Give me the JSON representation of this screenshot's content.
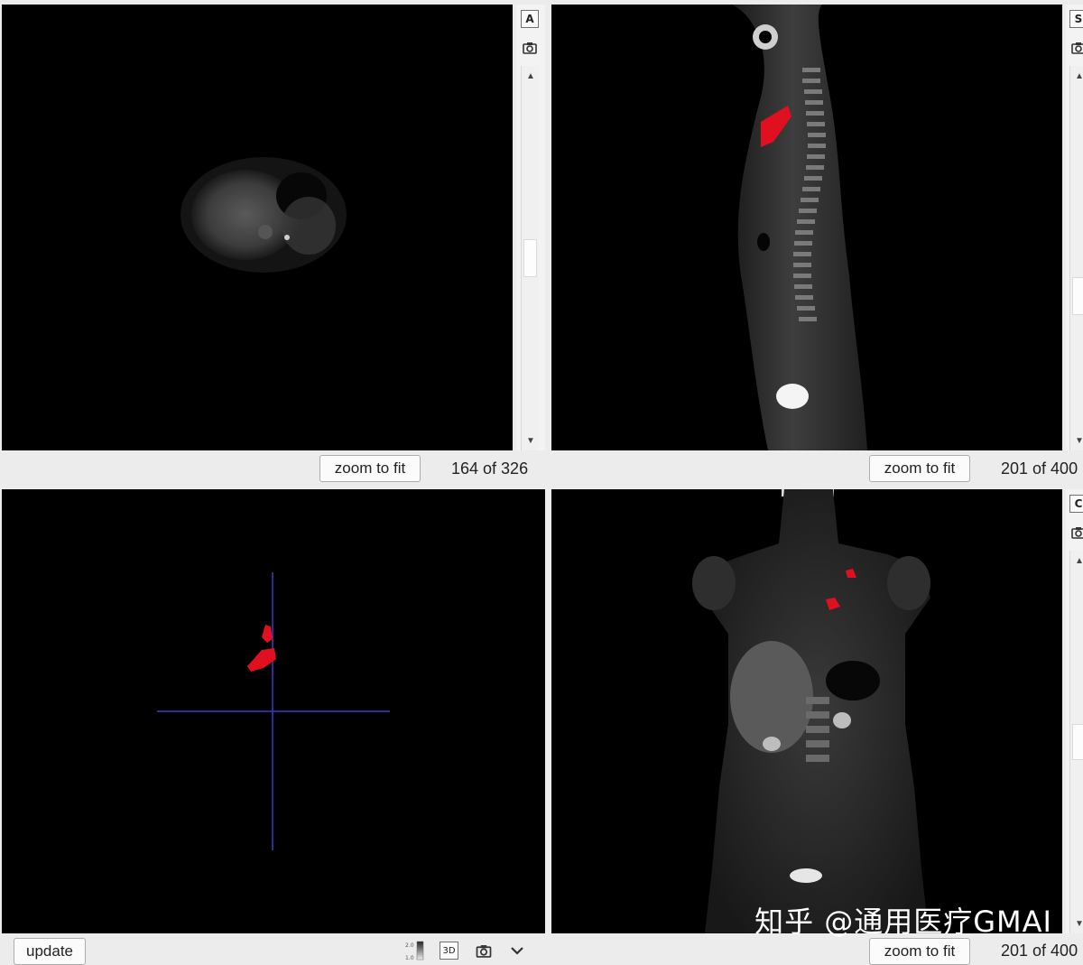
{
  "views": {
    "axial": {
      "zoom_label": "zoom to fit",
      "slice_counter": "164 of 326",
      "orientation_button": "A"
    },
    "sagittal": {
      "zoom_label": "zoom to fit",
      "slice_counter": "201 of 400",
      "orientation_button": "S"
    },
    "render3d": {
      "update_label": "update",
      "mode_3d_label": "3D",
      "colorbar_max": "2.0",
      "colorbar_min": "1.0"
    },
    "coronal": {
      "zoom_label": "zoom to fit",
      "slice_counter": "201 of 400",
      "orientation_button": "C"
    }
  },
  "watermark": "知乎 @通用医疗GMAI",
  "colors": {
    "viewport_bg": "#000000",
    "segmentation": "#e01020",
    "crosshair": "#3a3ac8",
    "panel_bg": "#ececec"
  },
  "icons": [
    "camera-icon",
    "arrow-up-icon",
    "arrow-down-icon",
    "chevron-down-icon",
    "colorbar-icon"
  ]
}
